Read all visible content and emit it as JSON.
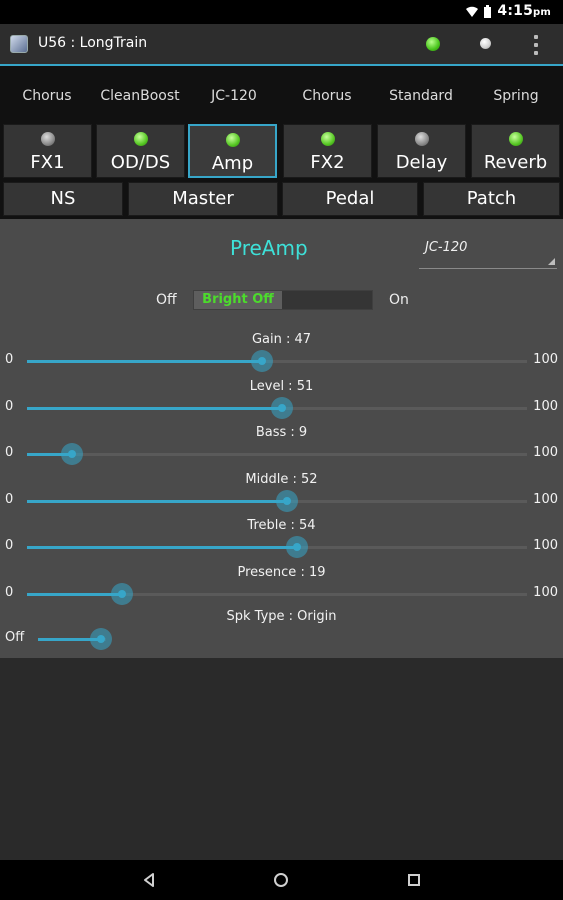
{
  "status_bar": {
    "time": "4:15",
    "ampm": "pm",
    "icons": [
      "wifi-icon",
      "battery-icon"
    ]
  },
  "action_bar": {
    "title": "U56 : LongTrain",
    "icons": [
      "app-icon",
      "green-led-icon",
      "white-led-icon",
      "overflow-menu-icon"
    ]
  },
  "effect_names": [
    "Chorus",
    "CleanBoost",
    "JC-120",
    "Chorus",
    "Standard",
    "Spring"
  ],
  "effect_buttons": [
    {
      "label": "FX1",
      "led": "grey"
    },
    {
      "label": "OD/DS",
      "led": "green"
    },
    {
      "label": "Amp",
      "led": "green",
      "selected": true
    },
    {
      "label": "FX2",
      "led": "green"
    },
    {
      "label": "Delay",
      "led": "grey"
    },
    {
      "label": "Reverb",
      "led": "green"
    }
  ],
  "second_row": [
    "NS",
    "Master",
    "Pedal",
    "Patch"
  ],
  "panel": {
    "title": "PreAmp",
    "amp_type": "JC-120",
    "bright": {
      "off_label": "Off",
      "on_label": "On",
      "state_label": "Bright Off",
      "state": "off"
    },
    "sliders": [
      {
        "label": "Gain : 47",
        "min": "0",
        "max": "100",
        "value": 47
      },
      {
        "label": "Level : 51",
        "min": "0",
        "max": "100",
        "value": 51
      },
      {
        "label": "Bass : 9",
        "min": "0",
        "max": "100",
        "value": 9
      },
      {
        "label": "Middle : 52",
        "min": "0",
        "max": "100",
        "value": 52
      },
      {
        "label": "Treble : 54",
        "min": "0",
        "max": "100",
        "value": 54
      },
      {
        "label": "Presence : 19",
        "min": "0",
        "max": "100",
        "value": 19
      }
    ],
    "spk": {
      "label": "Spk Type : Origin",
      "min": "Off",
      "value": "Origin"
    }
  },
  "nav_bar": {
    "icons": [
      "back-icon",
      "home-icon",
      "recents-icon"
    ]
  },
  "colors": {
    "accent": "#37a6c9",
    "title": "#3ee0d8",
    "led_green": "#56c723",
    "toggle_text": "#4cdb2c",
    "panel_bg": "#4b4b4b"
  }
}
